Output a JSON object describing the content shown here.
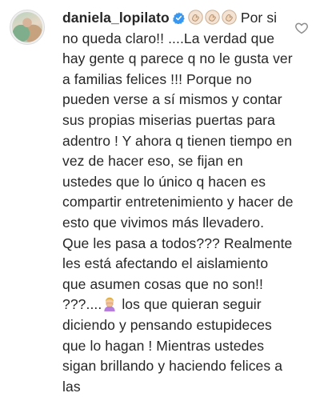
{
  "comment": {
    "username": "daniela_lopilato",
    "verified": true,
    "emojis_after_username": [
      "clapping-hands",
      "clapping-hands",
      "clapping-hands"
    ],
    "text_part1": " Por si no queda claro!! ....La verdad que hay gente q parece q no le gusta ver a familias felices !!! Porque no pueden verse a sí mismos y contar sus propias miserias puertas para adentro ! Y ahora q tienen tiempo en vez de hacer eso, se fijan en ustedes que lo único q hacen es compartir entretenimiento y hacer de esto que vivimos más llevadero. Que les pasa a todos??? Realmente les está afectando el aislamiento que asumen cosas que no son!! ???....",
    "inline_emoji": "person-facepalming",
    "text_part2": " los que quieran seguir diciendo y pensando estupideces que lo hagan ! Mientras ustedes sigan brillando y haciendo felices a las",
    "like_icon": "heart-outline-icon"
  },
  "colors": {
    "text": "#262626",
    "verified_badge": "#3897f0",
    "icon_gray": "#8e8e8e"
  }
}
